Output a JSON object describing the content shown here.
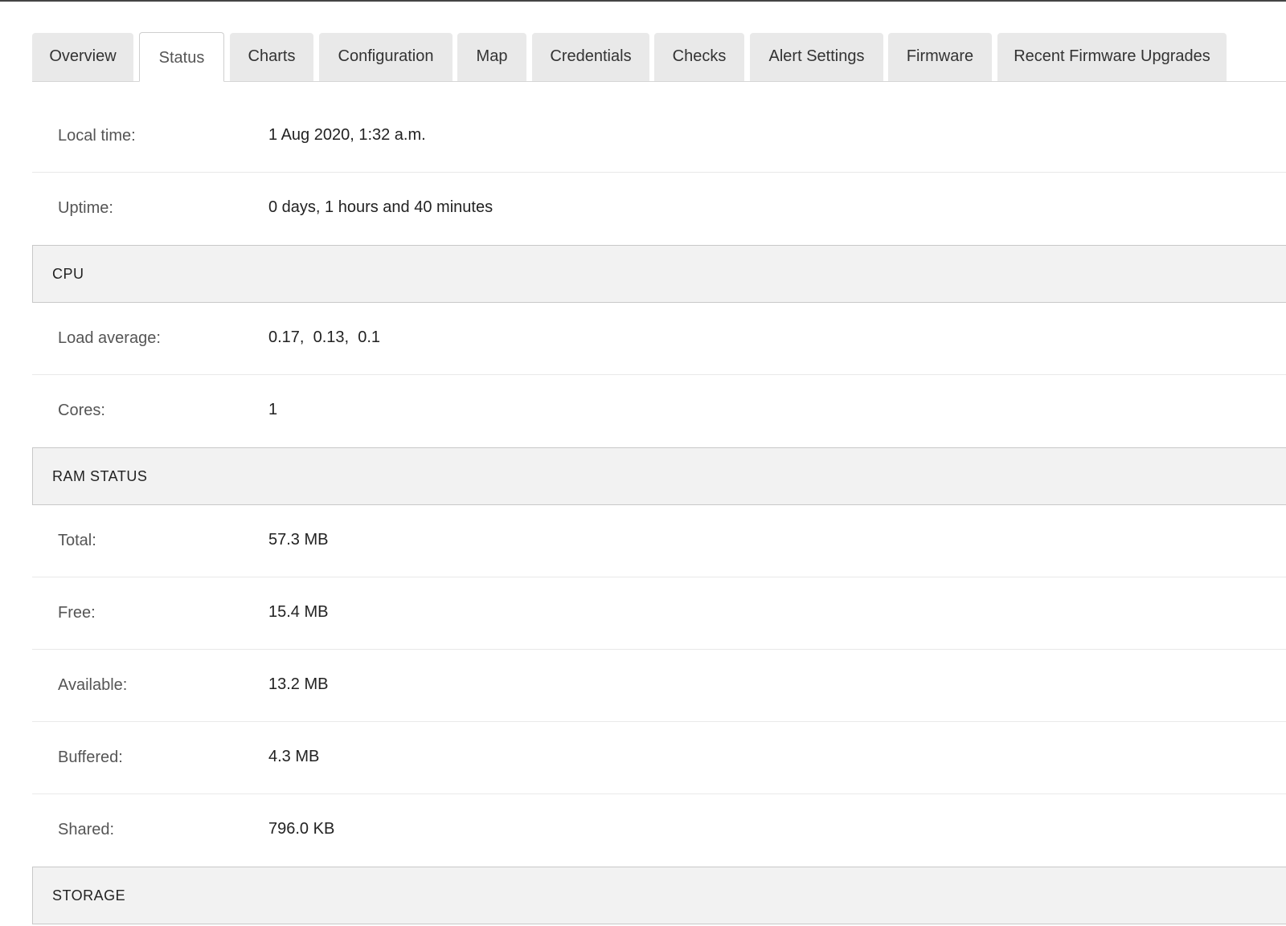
{
  "tabs": [
    {
      "label": "Overview",
      "active": false
    },
    {
      "label": "Status",
      "active": true
    },
    {
      "label": "Charts",
      "active": false
    },
    {
      "label": "Configuration",
      "active": false
    },
    {
      "label": "Map",
      "active": false
    },
    {
      "label": "Credentials",
      "active": false
    },
    {
      "label": "Checks",
      "active": false
    },
    {
      "label": "Alert Settings",
      "active": false
    },
    {
      "label": "Firmware",
      "active": false
    },
    {
      "label": "Recent Firmware Upgrades",
      "active": false
    }
  ],
  "general": {
    "local_time": {
      "label": "Local time:",
      "value": "1 Aug 2020, 1:32 a.m."
    },
    "uptime": {
      "label": "Uptime:",
      "value": "0 days, 1 hours and 40 minutes"
    }
  },
  "cpu": {
    "title": "CPU",
    "load_average": {
      "label": "Load average:",
      "value": "0.17,  0.13,  0.1"
    },
    "cores": {
      "label": "Cores:",
      "value": "1"
    }
  },
  "ram": {
    "title": "RAM STATUS",
    "total": {
      "label": "Total:",
      "value": "57.3 MB"
    },
    "free": {
      "label": "Free:",
      "value": "15.4 MB"
    },
    "available": {
      "label": "Available:",
      "value": "13.2 MB"
    },
    "buffered": {
      "label": "Buffered:",
      "value": "4.3 MB"
    },
    "shared": {
      "label": "Shared:",
      "value": "796.0 KB"
    }
  },
  "storage": {
    "title": "STORAGE"
  }
}
